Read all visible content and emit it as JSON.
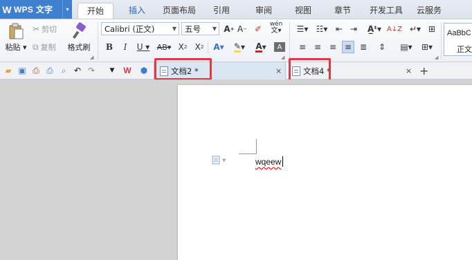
{
  "app": {
    "logo": "W",
    "name": "WPS 文字",
    "menu_arrow": "▾"
  },
  "menu_tabs": [
    {
      "label": "开始",
      "active": true
    },
    {
      "label": "插入",
      "active": false
    },
    {
      "label": "页面布局",
      "active": false
    },
    {
      "label": "引用",
      "active": false
    },
    {
      "label": "审阅",
      "active": false
    },
    {
      "label": "视图",
      "active": false
    },
    {
      "label": "章节",
      "active": false
    },
    {
      "label": "开发工具",
      "active": false
    },
    {
      "label": "云服务",
      "active": false
    }
  ],
  "ribbon": {
    "paste_label": "粘贴",
    "cut_label": "剪切",
    "copy_label": "复制",
    "format_painter_label": "格式刷",
    "font_name": "Calibri (正文)",
    "font_size": "五号",
    "style_preview_1": "AaBbC",
    "style_preview_2": "正文"
  },
  "doc_tabs": [
    {
      "title": "文档2 *",
      "active": true,
      "close": "×"
    },
    {
      "title": "文档4 *",
      "active": false,
      "close": "×"
    }
  ],
  "new_tab": "+",
  "document": {
    "text": "wqeew"
  },
  "colors": {
    "accent": "#3f7fcf",
    "highlight_box": "#e0393e",
    "font_color_bar": "#e02020",
    "highlight_bar": "#ffe600"
  }
}
